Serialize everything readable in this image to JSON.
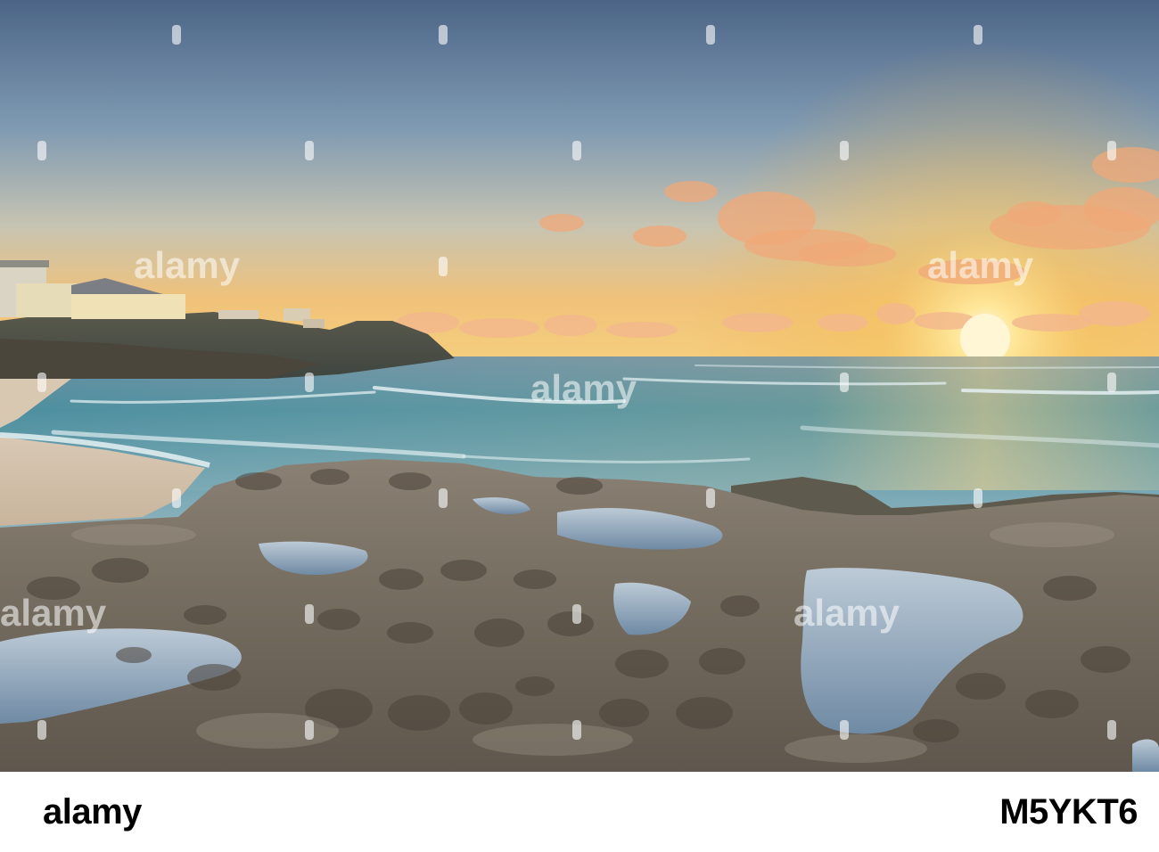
{
  "watermark": {
    "brand": "alamy"
  },
  "footer": {
    "logo": "alamy",
    "image_id": "M5YKT6"
  },
  "colors": {
    "sky_top": "#4d6a8c",
    "sky_horizon": "#f2b65c",
    "sun": "#fff2c4",
    "sea": "#3d8a9a",
    "rock": "#6e6559",
    "footer_bg": "#ffffff"
  }
}
